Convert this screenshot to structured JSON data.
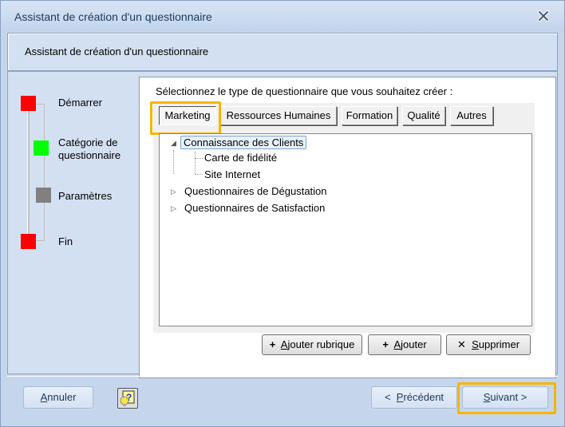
{
  "window": {
    "title": "Assistant de création d'un questionnaire",
    "close_icon": "close-x-icon"
  },
  "header": {
    "text": "Assistant de création d'un questionnaire"
  },
  "steps": [
    {
      "label": "Démarrer",
      "color": "#ff0000"
    },
    {
      "label": "Catégorie de questionnaire",
      "color": "#00ff00"
    },
    {
      "label": "Paramètres",
      "color": "#808080"
    },
    {
      "label": "Fin",
      "color": "#ff0000"
    }
  ],
  "panel": {
    "prompt": "Sélectionnez le type de questionnaire que vous souhaitez créer :",
    "tabs": [
      {
        "label": "Marketing",
        "active": true
      },
      {
        "label": "Ressources Humaines"
      },
      {
        "label": "Formation"
      },
      {
        "label": "Qualité"
      },
      {
        "label": "Autres"
      }
    ],
    "tree": [
      {
        "label": "Connaissance des Clients",
        "expanded": true,
        "selected": true,
        "children": [
          {
            "label": "Carte de fidélité"
          },
          {
            "label": "Site Internet"
          }
        ]
      },
      {
        "label": "Questionnaires de Dégustation",
        "expanded": false
      },
      {
        "label": "Questionnaires de Satisfaction",
        "expanded": false
      }
    ],
    "buttons": {
      "add_section_prefix": "+",
      "add_section_mnemonic": "A",
      "add_section_rest": "jouter rubrique",
      "add_prefix": "+",
      "add_mnemonic": "A",
      "add_rest": "jouter",
      "delete_prefix": "✕",
      "delete_mnemonic": "S",
      "delete_rest": "upprimer"
    }
  },
  "footer": {
    "cancel_mnemonic": "A",
    "cancel_rest": "nnuler",
    "help_icon": "help-bulb-icon",
    "prev_prefix": "<",
    "prev_mnemonic": "P",
    "prev_rest": "récédent",
    "next_mnemonic": "S",
    "next_rest": "uivant",
    "next_suffix": ">"
  },
  "highlight_color": "#f7b500"
}
